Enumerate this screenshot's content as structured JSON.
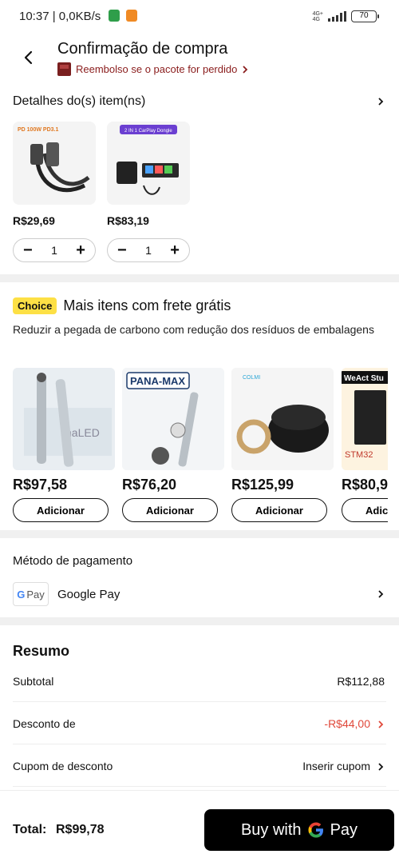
{
  "status": {
    "time": "10:37",
    "speed": "| 0,0KB/s",
    "network_top": "4G+",
    "network_bottom": "4G",
    "battery": "70"
  },
  "header": {
    "title": "Confirmação de compra",
    "refund_text": "Reembolso se o pacote for perdido"
  },
  "items_section": {
    "title": "Detalhes do(s) item(ns)",
    "items": [
      {
        "price": "R$29,69",
        "qty": "1",
        "thumb_text": "PD 100W PD3.1"
      },
      {
        "price": "R$83,19",
        "qty": "1",
        "thumb_text": "2 IN 1 CarPlay Dongle"
      }
    ]
  },
  "choice_section": {
    "badge": "Choice",
    "title": "Mais itens com frete grátis",
    "description": "Reduzir a pegada de carbono com redução dos resíduos de embalagens",
    "add_label": "Adicionar",
    "products": [
      {
        "price": "R$97,58",
        "thumb_text": "naLED"
      },
      {
        "price": "R$76,20",
        "thumb_text": "PANA-MAX"
      },
      {
        "price": "R$125,99",
        "thumb_text": "COLMI"
      },
      {
        "price": "R$80,9",
        "thumb_text": "WeAct Stu"
      }
    ]
  },
  "payment": {
    "title": "Método de pagamento",
    "method_logo": "G Pay",
    "method_name": "Google Pay"
  },
  "summary": {
    "title": "Resumo",
    "subtotal_label": "Subtotal",
    "subtotal_value": "R$112,88",
    "discount_label": "Desconto de",
    "discount_value": "-R$44,00",
    "coupon_label": "Cupom de desconto",
    "coupon_value": "Inserir cupom"
  },
  "footer": {
    "total_label": "Total:",
    "total_value": "R$99,78",
    "buy_label": "Buy with",
    "buy_pay": "Pay"
  },
  "colors": {
    "accent_red": "#e0483a",
    "choice_yellow": "#fde045",
    "refund_brown": "#8a1c1c"
  }
}
